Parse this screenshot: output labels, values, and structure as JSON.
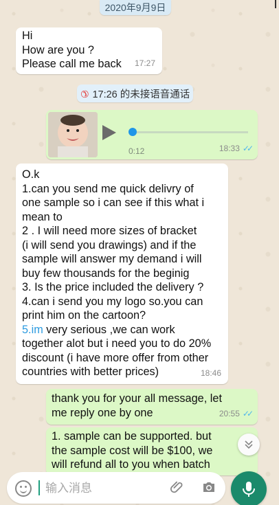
{
  "date_pill": "2020年9月9日",
  "messages": {
    "greeting": {
      "lines": [
        "Hi",
        "How are you ?",
        "Please call me back"
      ],
      "time": "17:27"
    },
    "missed_call": "17:26 的未接语音通话",
    "voice_note": {
      "duration": "0:12",
      "time": "18:33",
      "progress": 0
    },
    "long_message": {
      "lines": [
        "O.k",
        "1.can you send me quick delivry of",
        "one sample so i can see if this what i",
        "mean to",
        "2 . I will need more sizes of bracket",
        "(i will send you drawings) and if the",
        "sample will answer my demand i will",
        "buy few thousands for the beginig",
        " 3. Is the price included the delivery ?",
        "4.can i send you my logo so.you can",
        "print him on the cartoon?"
      ],
      "link": "5.im",
      "link_rest": " very serious ,we can work",
      "tail_lines": [
        "together alot but i need you to do 20%",
        "discount (i have more offer from other",
        "countries with better prices)"
      ],
      "time": "18:46"
    },
    "reply_1": {
      "lines": [
        "thank you for your all message, let",
        "me reply one by one"
      ],
      "time": "20:55"
    },
    "reply_2": {
      "lines": [
        "1. sample can be supported. but",
        "the sample cost will be $100, we",
        "will refund all to you when batch"
      ]
    }
  },
  "input": {
    "placeholder": "输入消息"
  },
  "icons": {
    "missed_call": "missed-call-icon",
    "play": "play-icon",
    "read_ticks": "double-check-icon",
    "scroll_down": "chevron-double-down-icon",
    "emoji": "emoji-icon",
    "attach": "paperclip-icon",
    "camera": "camera-icon",
    "mic": "microphone-icon"
  },
  "colors": {
    "outgoing_bubble": "#dcf8c6",
    "incoming_bubble": "#ffffff",
    "mic_button": "#1b8a6b",
    "ticks": "#4fb6ec",
    "link": "#2c9be0"
  }
}
